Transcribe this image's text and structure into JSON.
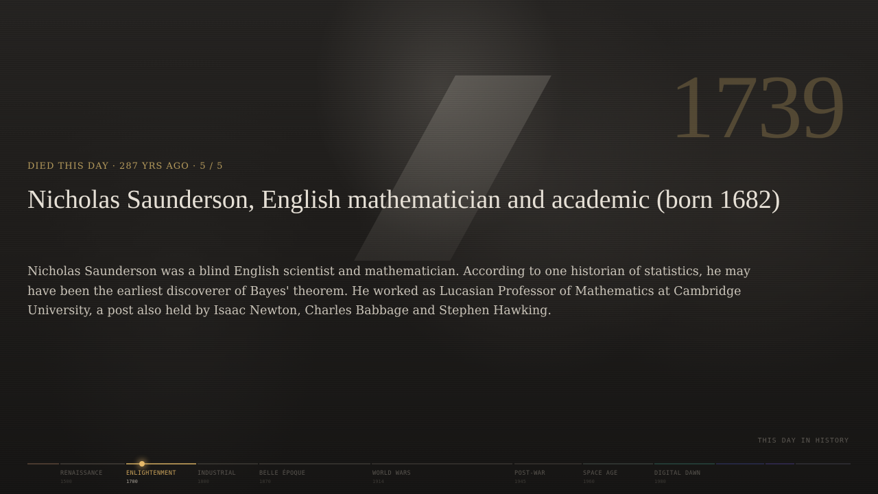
{
  "event": {
    "meta": "DIED THIS DAY · 287 YRS AGO · 5 / 5",
    "year": "1739",
    "title": "Nicholas Saunderson, English mathematician and academic (born 1682)",
    "description": "Nicholas Saunderson was a blind English scientist and mathematician. According to one historian of statistics, he may have been the earliest discoverer of Bayes' theorem. He worked as Lucasian Professor of Mathematics at Cambridge University, a post also held by Isaac Newton, Charles Babbage and Stephen Hawking."
  },
  "brand": "THIS DAY IN HISTORY",
  "timeline": {
    "eras": [
      {
        "label": "RENAISSANCE",
        "year": "1500"
      },
      {
        "label": "ENLIGHTENMENT",
        "year": "1700"
      },
      {
        "label": "INDUSTRIAL",
        "year": "1800"
      },
      {
        "label": "BELLE ÉPOQUE",
        "year": "1870"
      },
      {
        "label": "WORLD WARS",
        "year": "1914"
      },
      {
        "label": "POST-WAR",
        "year": "1945"
      },
      {
        "label": "SPACE AGE",
        "year": "1960"
      },
      {
        "label": "DIGITAL DAWN",
        "year": "1980"
      }
    ]
  },
  "colors": {
    "accent": "#c9a25a",
    "background": "#1e1c1a",
    "text": "#e6e0d6"
  }
}
